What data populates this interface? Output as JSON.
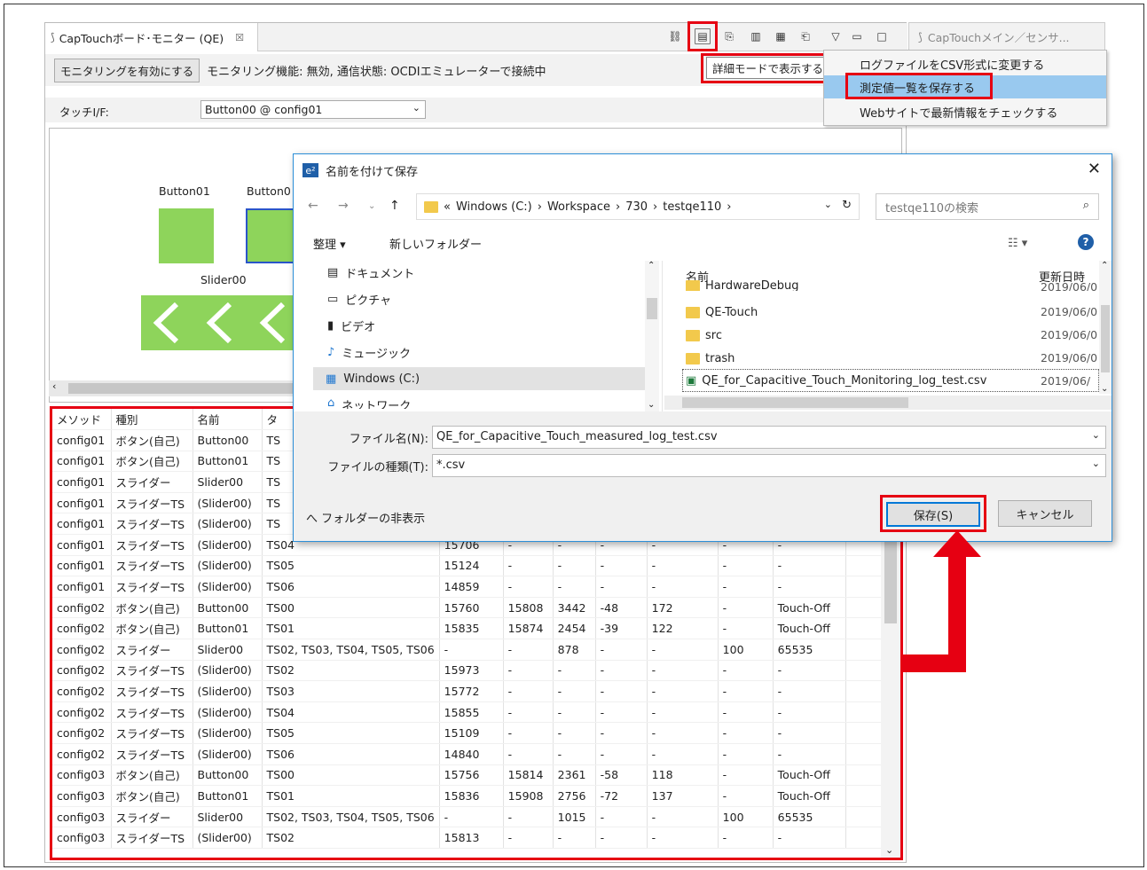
{
  "panel": {
    "tab_title": "CapTouchボード･モニター (QE)",
    "tab_close": "☒",
    "monitor_button": "モニタリングを有効にする",
    "status_text": "モニタリング機能: 無効, 通信状態: OCDIエミュレーターで接続中",
    "touch_label": "タッチI/F:",
    "touch_value": "Button00 @ config01",
    "canvas": {
      "button01": "Button01",
      "button0_partial": "Button0",
      "slider": "Slider00"
    }
  },
  "right_view_title": "CapTouchメイン／センサ...",
  "tooltip": "詳細モードで表示する",
  "menu": {
    "items": [
      "ログファイルをCSV形式に変更する",
      "測定値一覧を保存する",
      "Webサイトで最新情報をチェックする"
    ],
    "selected_index": 1
  },
  "table": {
    "headers": [
      "メソッド",
      "種別",
      "名前",
      "タ"
    ],
    "rows": [
      [
        "config01",
        "ボタン(自己)",
        "Button00",
        "TS",
        "",
        "",
        "",
        "",
        "",
        "",
        "",
        ""
      ],
      [
        "config01",
        "ボタン(自己)",
        "Button01",
        "TS",
        "",
        "",
        "",
        "",
        "",
        "",
        "",
        ""
      ],
      [
        "config01",
        "スライダー",
        "Slider00",
        "TS",
        "",
        "",
        "",
        "",
        "",
        "",
        "",
        ""
      ],
      [
        "config01",
        "スライダーTS",
        "(Slider00)",
        "TS",
        "",
        "",
        "",
        "",
        "",
        "",
        "",
        ""
      ],
      [
        "config01",
        "スライダーTS",
        "(Slider00)",
        "TS",
        "",
        "",
        "",
        "",
        "",
        "",
        "",
        ""
      ],
      [
        "config01",
        "スライダーTS",
        "(Slider00)",
        "TS04",
        "15706",
        "-",
        "-",
        "-",
        "-",
        "-",
        "-",
        ""
      ],
      [
        "config01",
        "スライダーTS",
        "(Slider00)",
        "TS05",
        "15124",
        "-",
        "-",
        "-",
        "-",
        "-",
        "-",
        ""
      ],
      [
        "config01",
        "スライダーTS",
        "(Slider00)",
        "TS06",
        "14859",
        "-",
        "-",
        "-",
        "-",
        "-",
        "-",
        ""
      ],
      [
        "config02",
        "ボタン(自己)",
        "Button00",
        "TS00",
        "15760",
        "15808",
        "3442",
        "-48",
        "172",
        "-",
        "Touch-Off",
        ""
      ],
      [
        "config02",
        "ボタン(自己)",
        "Button01",
        "TS01",
        "15835",
        "15874",
        "2454",
        "-39",
        "122",
        "-",
        "Touch-Off",
        ""
      ],
      [
        "config02",
        "スライダー",
        "Slider00",
        "TS02, TS03, TS04, TS05, TS06",
        "-",
        "-",
        "878",
        "-",
        "-",
        "100",
        "65535",
        ""
      ],
      [
        "config02",
        "スライダーTS",
        "(Slider00)",
        "TS02",
        "15973",
        "-",
        "-",
        "-",
        "-",
        "-",
        "-",
        ""
      ],
      [
        "config02",
        "スライダーTS",
        "(Slider00)",
        "TS03",
        "15772",
        "-",
        "-",
        "-",
        "-",
        "-",
        "-",
        ""
      ],
      [
        "config02",
        "スライダーTS",
        "(Slider00)",
        "TS04",
        "15855",
        "-",
        "-",
        "-",
        "-",
        "-",
        "-",
        ""
      ],
      [
        "config02",
        "スライダーTS",
        "(Slider00)",
        "TS05",
        "15109",
        "-",
        "-",
        "-",
        "-",
        "-",
        "-",
        ""
      ],
      [
        "config02",
        "スライダーTS",
        "(Slider00)",
        "TS06",
        "14840",
        "-",
        "-",
        "-",
        "-",
        "-",
        "-",
        ""
      ],
      [
        "config03",
        "ボタン(自己)",
        "Button00",
        "TS00",
        "15756",
        "15814",
        "2361",
        "-58",
        "118",
        "-",
        "Touch-Off",
        ""
      ],
      [
        "config03",
        "ボタン(自己)",
        "Button01",
        "TS01",
        "15836",
        "15908",
        "2756",
        "-72",
        "137",
        "-",
        "Touch-Off",
        ""
      ],
      [
        "config03",
        "スライダー",
        "Slider00",
        "TS02, TS03, TS04, TS05, TS06",
        "-",
        "-",
        "1015",
        "-",
        "-",
        "100",
        "65535",
        ""
      ],
      [
        "config03",
        "スライダーTS",
        "(Slider00)",
        "TS02",
        "15813",
        "-",
        "-",
        "-",
        "-",
        "-",
        "-",
        ""
      ]
    ]
  },
  "dialog": {
    "title": "名前を付けて保存",
    "logo": "e²",
    "close": "✕",
    "breadcrumb": [
      "«",
      "Windows (C:)",
      "›",
      "Workspace",
      "›",
      "730",
      "›",
      "testqe110",
      "›"
    ],
    "search_placeholder": "testqe110の検索",
    "organize": "整理 ▾",
    "new_folder": "新しいフォルダー",
    "nav_items": [
      "ドキュメント",
      "ピクチャ",
      "ビデオ",
      "ミュージック",
      "Windows (C:)",
      "ネットワーク"
    ],
    "list_header_name": "名前",
    "list_header_date": "更新日時",
    "files": [
      {
        "name": "HardwareDebug",
        "date": "2019/06/0"
      },
      {
        "name": "QE-Touch",
        "date": "2019/06/0"
      },
      {
        "name": "src",
        "date": "2019/06/0"
      },
      {
        "name": "trash",
        "date": "2019/06/0"
      },
      {
        "name": "QE_for_Capacitive_Touch_Monitoring_log_test.csv",
        "date": "2019/06/"
      }
    ],
    "filename_label": "ファイル名(N):",
    "filename_value": "QE_for_Capacitive_Touch_measured_log_test.csv",
    "filetype_label": "ファイルの種類(T):",
    "filetype_value": "*.csv",
    "hide_folders": "へ フォルダーの非表示",
    "save": "保存(S)",
    "cancel": "キャンセル"
  },
  "colors": {
    "highlight": "#e60012",
    "button_green": "#8ed45b",
    "menu_selected": "#99c9ef"
  }
}
